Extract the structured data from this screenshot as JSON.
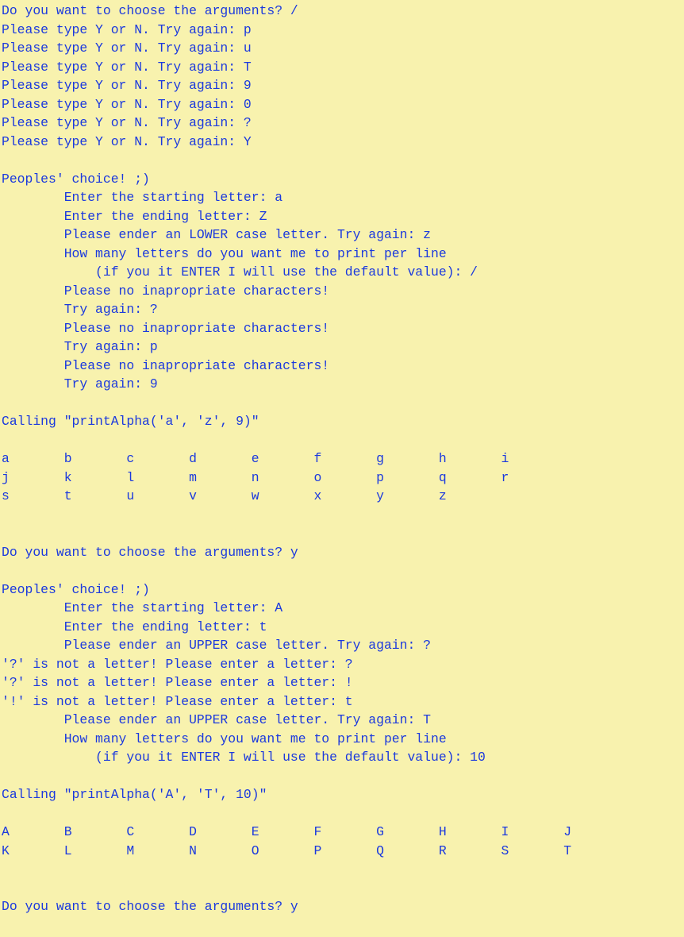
{
  "colors": {
    "background": "#f8f2ae",
    "text": "#1b39de"
  },
  "terminal": {
    "lines": [
      "Do you want to choose the arguments? /",
      "Please type Y or N. Try again: p",
      "Please type Y or N. Try again: u",
      "Please type Y or N. Try again: T",
      "Please type Y or N. Try again: 9",
      "Please type Y or N. Try again: 0",
      "Please type Y or N. Try again: ?",
      "Please type Y or N. Try again: Y",
      "",
      "Peoples' choice! ;)",
      "        Enter the starting letter: a",
      "        Enter the ending letter: Z",
      "        Please ender an LOWER case letter. Try again: z",
      "        How many letters do you want me to print per line",
      "            (if you it ENTER I will use the default value): /",
      "        Please no inapropriate characters!",
      "        Try again: ?",
      "        Please no inapropriate characters!",
      "        Try again: p",
      "        Please no inapropriate characters!",
      "        Try again: 9",
      "",
      "Calling \"printAlpha('a', 'z', 9)\"",
      "",
      "a       b       c       d       e       f       g       h       i",
      "j       k       l       m       n       o       p       q       r",
      "s       t       u       v       w       x       y       z",
      "",
      "",
      "Do you want to choose the arguments? y",
      "",
      "Peoples' choice! ;)",
      "        Enter the starting letter: A",
      "        Enter the ending letter: t",
      "        Please ender an UPPER case letter. Try again: ?",
      "'?' is not a letter! Please enter a letter: ?",
      "'?' is not a letter! Please enter a letter: !",
      "'!' is not a letter! Please enter a letter: t",
      "        Please ender an UPPER case letter. Try again: T",
      "        How many letters do you want me to print per line",
      "            (if you it ENTER I will use the default value): 10",
      "",
      "Calling \"printAlpha('A', 'T', 10)\"",
      "",
      "A       B       C       D       E       F       G       H       I       J",
      "K       L       M       N       O       P       Q       R       S       T",
      "",
      "",
      "Do you want to choose the arguments? y"
    ]
  }
}
